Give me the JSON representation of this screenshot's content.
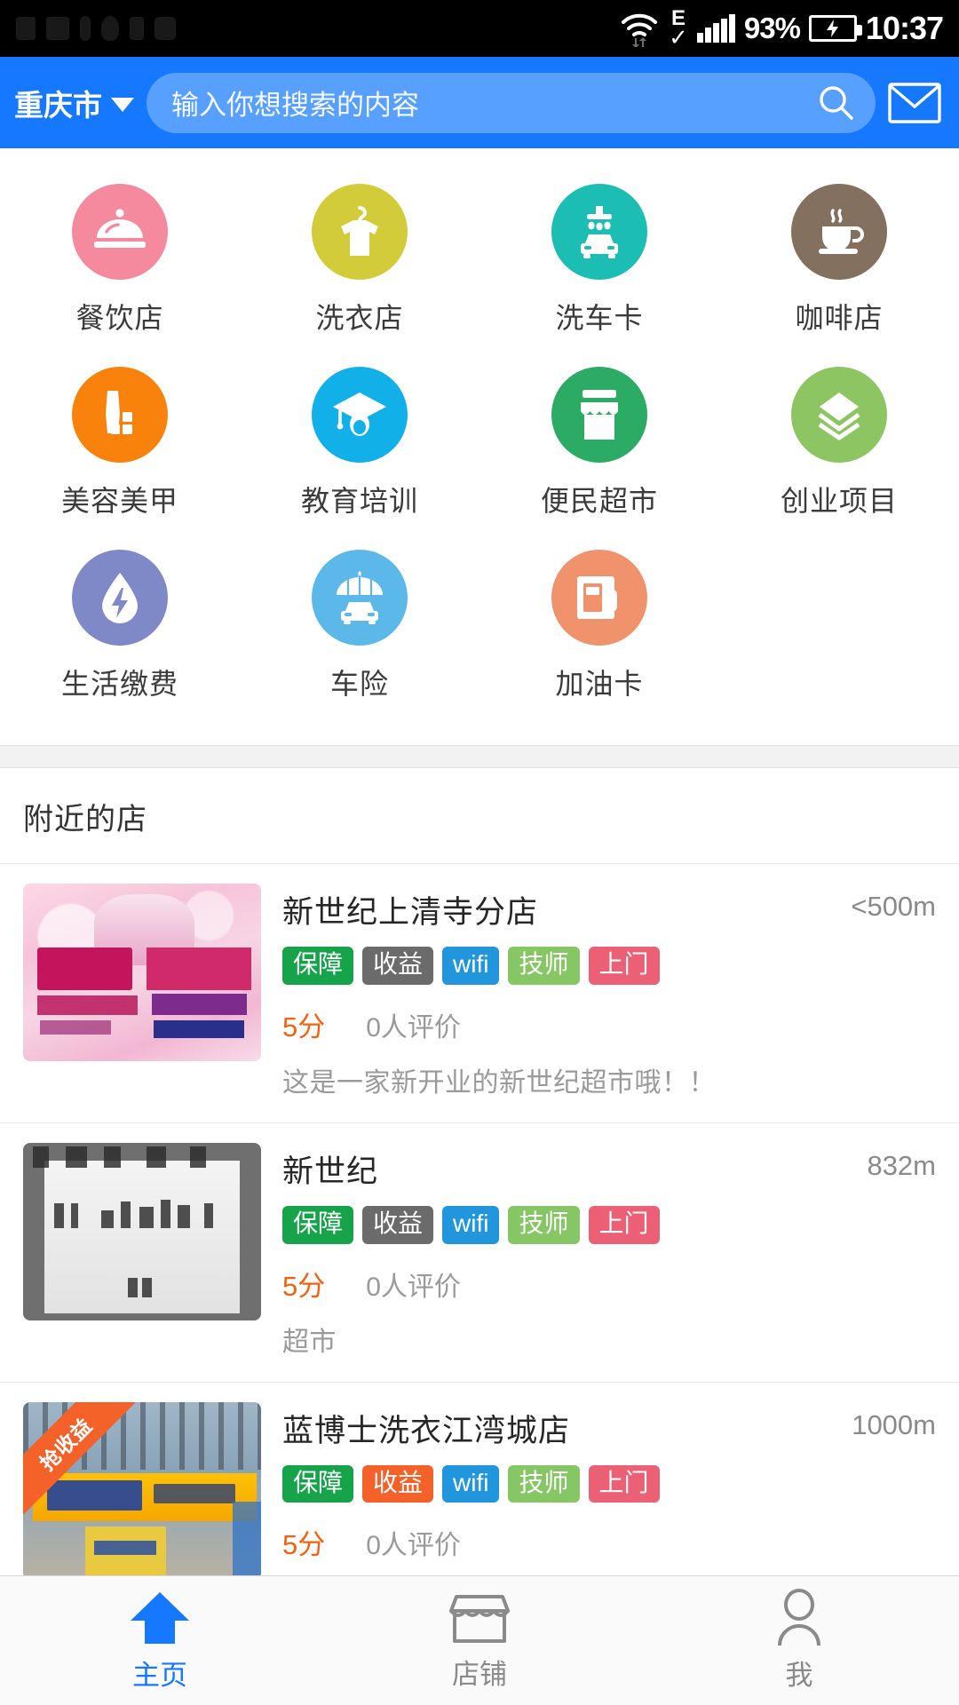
{
  "statusbar": {
    "network_label": "E",
    "battery_percent": "93%",
    "clock": "10:37",
    "wifi_icon": "wifi-icon",
    "signal_icon": "signal-bars-icon",
    "battery_icon": "battery-charging-icon",
    "check_icon": "check-icon"
  },
  "header": {
    "city": "重庆市",
    "city_chevron_icon": "chevron-down-icon",
    "search_placeholder": "输入你想搜索的内容",
    "search_value": "",
    "search_icon": "search-icon",
    "mail_icon": "mail-icon"
  },
  "categories": [
    {
      "label": "餐饮店",
      "icon": "food-cloche-icon",
      "color": "#f58a9e"
    },
    {
      "label": "洗衣店",
      "icon": "laundry-shirt-icon",
      "color": "#d3cc3a"
    },
    {
      "label": "洗车卡",
      "icon": "car-wash-icon",
      "color": "#1cbeb4"
    },
    {
      "label": "咖啡店",
      "icon": "coffee-cup-icon",
      "color": "#83705e"
    },
    {
      "label": "美容美甲",
      "icon": "cosmetics-icon",
      "color": "#f8820b"
    },
    {
      "label": "教育培训",
      "icon": "graduation-cap-icon",
      "color": "#12b0e8"
    },
    {
      "label": "便民超市",
      "icon": "storefront-icon",
      "color": "#2bab63"
    },
    {
      "label": "创业项目",
      "icon": "layers-icon",
      "color": "#8cc561"
    },
    {
      "label": "生活缴费",
      "icon": "water-drop-bolt-icon",
      "color": "#8089c8"
    },
    {
      "label": "车险",
      "icon": "car-umbrella-icon",
      "color": "#5bb8e8"
    },
    {
      "label": "加油卡",
      "icon": "fuel-pump-icon",
      "color": "#f0926c"
    }
  ],
  "nearby": {
    "section_title": "附近的店",
    "stores": [
      {
        "name": "新世纪上清寺分店",
        "distance": "<500m",
        "tags": [
          {
            "label": "保障",
            "color": "#16a34a"
          },
          {
            "label": "收益",
            "color": "#6b6b6b"
          },
          {
            "label": "wifi",
            "color": "#2196dd"
          },
          {
            "label": "技师",
            "color": "#86c665"
          },
          {
            "label": "上门",
            "color": "#ec6075"
          }
        ],
        "score": "5分",
        "reviews": "0人评价",
        "desc": "这是一家新开业的新世纪超市哦！！",
        "ribbon": "",
        "thumb": "dress-ad-poster"
      },
      {
        "name": "新世纪",
        "distance": "832m",
        "tags": [
          {
            "label": "保障",
            "color": "#16a34a"
          },
          {
            "label": "收益",
            "color": "#6b6b6b"
          },
          {
            "label": "wifi",
            "color": "#2196dd"
          },
          {
            "label": "技师",
            "color": "#86c665"
          },
          {
            "label": "上门",
            "color": "#ec6075"
          }
        ],
        "score": "5分",
        "reviews": "0人评价",
        "desc": "超市",
        "ribbon": "",
        "thumb": "receipt-photo"
      },
      {
        "name": "蓝博士洗衣江湾城店",
        "distance": "1000m",
        "tags": [
          {
            "label": "保障",
            "color": "#16a34a"
          },
          {
            "label": "收益",
            "color": "#f4622a"
          },
          {
            "label": "wifi",
            "color": "#2196dd"
          },
          {
            "label": "技师",
            "color": "#86c665"
          },
          {
            "label": "上门",
            "color": "#ec6075"
          }
        ],
        "score": "5分",
        "reviews": "0人评价",
        "desc": "",
        "ribbon": "抢收益",
        "thumb": "storefront-photo"
      }
    ]
  },
  "tabbar": {
    "items": [
      {
        "label": "主页",
        "icon": "home-arrow-icon",
        "active": true
      },
      {
        "label": "店铺",
        "icon": "shop-icon",
        "active": false
      },
      {
        "label": "我",
        "icon": "person-icon",
        "active": false
      }
    ],
    "active_color": "#1678ff",
    "inactive_color": "#8a8a8a"
  }
}
